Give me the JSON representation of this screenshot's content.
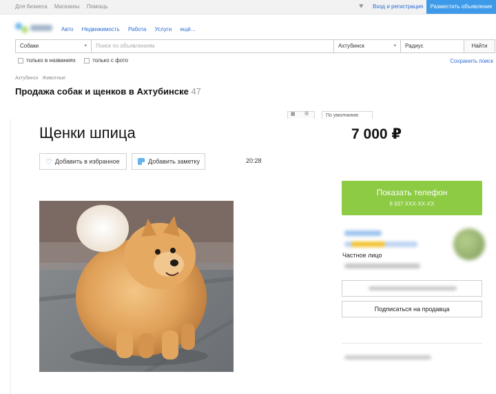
{
  "topbar": {
    "links": [
      "Для бизнеса",
      "Магазины",
      "Помощь"
    ],
    "login": "Вход и регистрация",
    "post_ad": "Разместить объявление"
  },
  "nav": {
    "categories": [
      "Авто",
      "Недвижимость",
      "Работа",
      "Услуги",
      "ещё..."
    ]
  },
  "search": {
    "category": "Собаки",
    "query_placeholder": "Поиск по объявлениям",
    "city": "Ахтубинск",
    "radius": "Радиус",
    "submit": "Найти"
  },
  "filters": {
    "only_titles": "только в названиях",
    "only_photo": "только с фото",
    "save_search": "Сохранить поиск"
  },
  "breadcrumbs": [
    "Ахтубинск",
    "Животные"
  ],
  "listing_header": {
    "title": "Продажа собак и щенков в Ахтубинске",
    "count": "47",
    "sort": "По умолчанию"
  },
  "ad": {
    "title": "Щенки шпица",
    "price": "7 000 ₽",
    "add_favorite": "Добавить в избранное",
    "add_note": "Добавить заметку",
    "time": "20:28",
    "call_button": "Показать телефон",
    "phone_masked": "8 937 XXX-XX-XX",
    "seller_type": "Частное лицо",
    "subscribe": "Подписаться на продавца"
  },
  "colors": {
    "accent_blue": "#3d9ae8",
    "link_blue": "#2a6bd1",
    "call_green": "#8ccb43"
  },
  "icons": [
    "heart-icon",
    "chevron-down-icon",
    "heart-outline-icon",
    "note-icon",
    "grid-view-icon",
    "list-view-icon"
  ]
}
